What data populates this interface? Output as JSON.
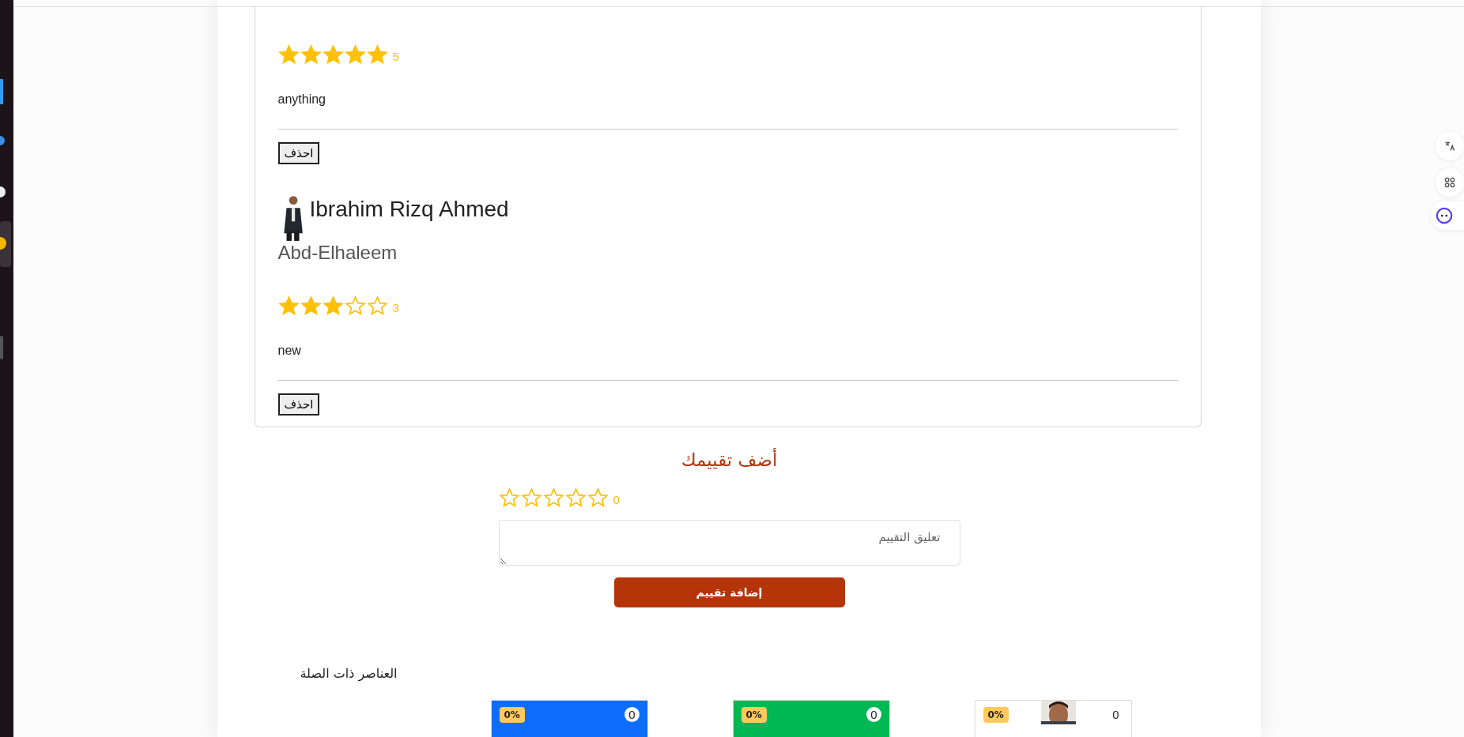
{
  "reviews": [
    {
      "stars": 5,
      "rating_text": "5",
      "comment": "anything",
      "delete_button": "احذف"
    },
    {
      "name": "Ibrahim Rizq Ahmed",
      "surname": "Abd-Elhaleem",
      "stars": 3,
      "rating_text": "3",
      "comment": "new",
      "delete_button": "احذف"
    }
  ],
  "add_review": {
    "title": "أضف تقييمك",
    "stars": 0,
    "rating_text": "0",
    "comment_field": {
      "placeholder": "تعليق التقييم"
    },
    "submit_button": "إضافة تقييم"
  },
  "related": {
    "title": "العناصر ذات الصلة",
    "products": [
      {
        "color": "#ffffff",
        "discount": "0%",
        "count": "0"
      },
      {
        "color": "#00b853",
        "discount": "0%",
        "count": "0"
      },
      {
        "color": "#0d6efd",
        "discount": "0%",
        "count": "0"
      }
    ]
  }
}
